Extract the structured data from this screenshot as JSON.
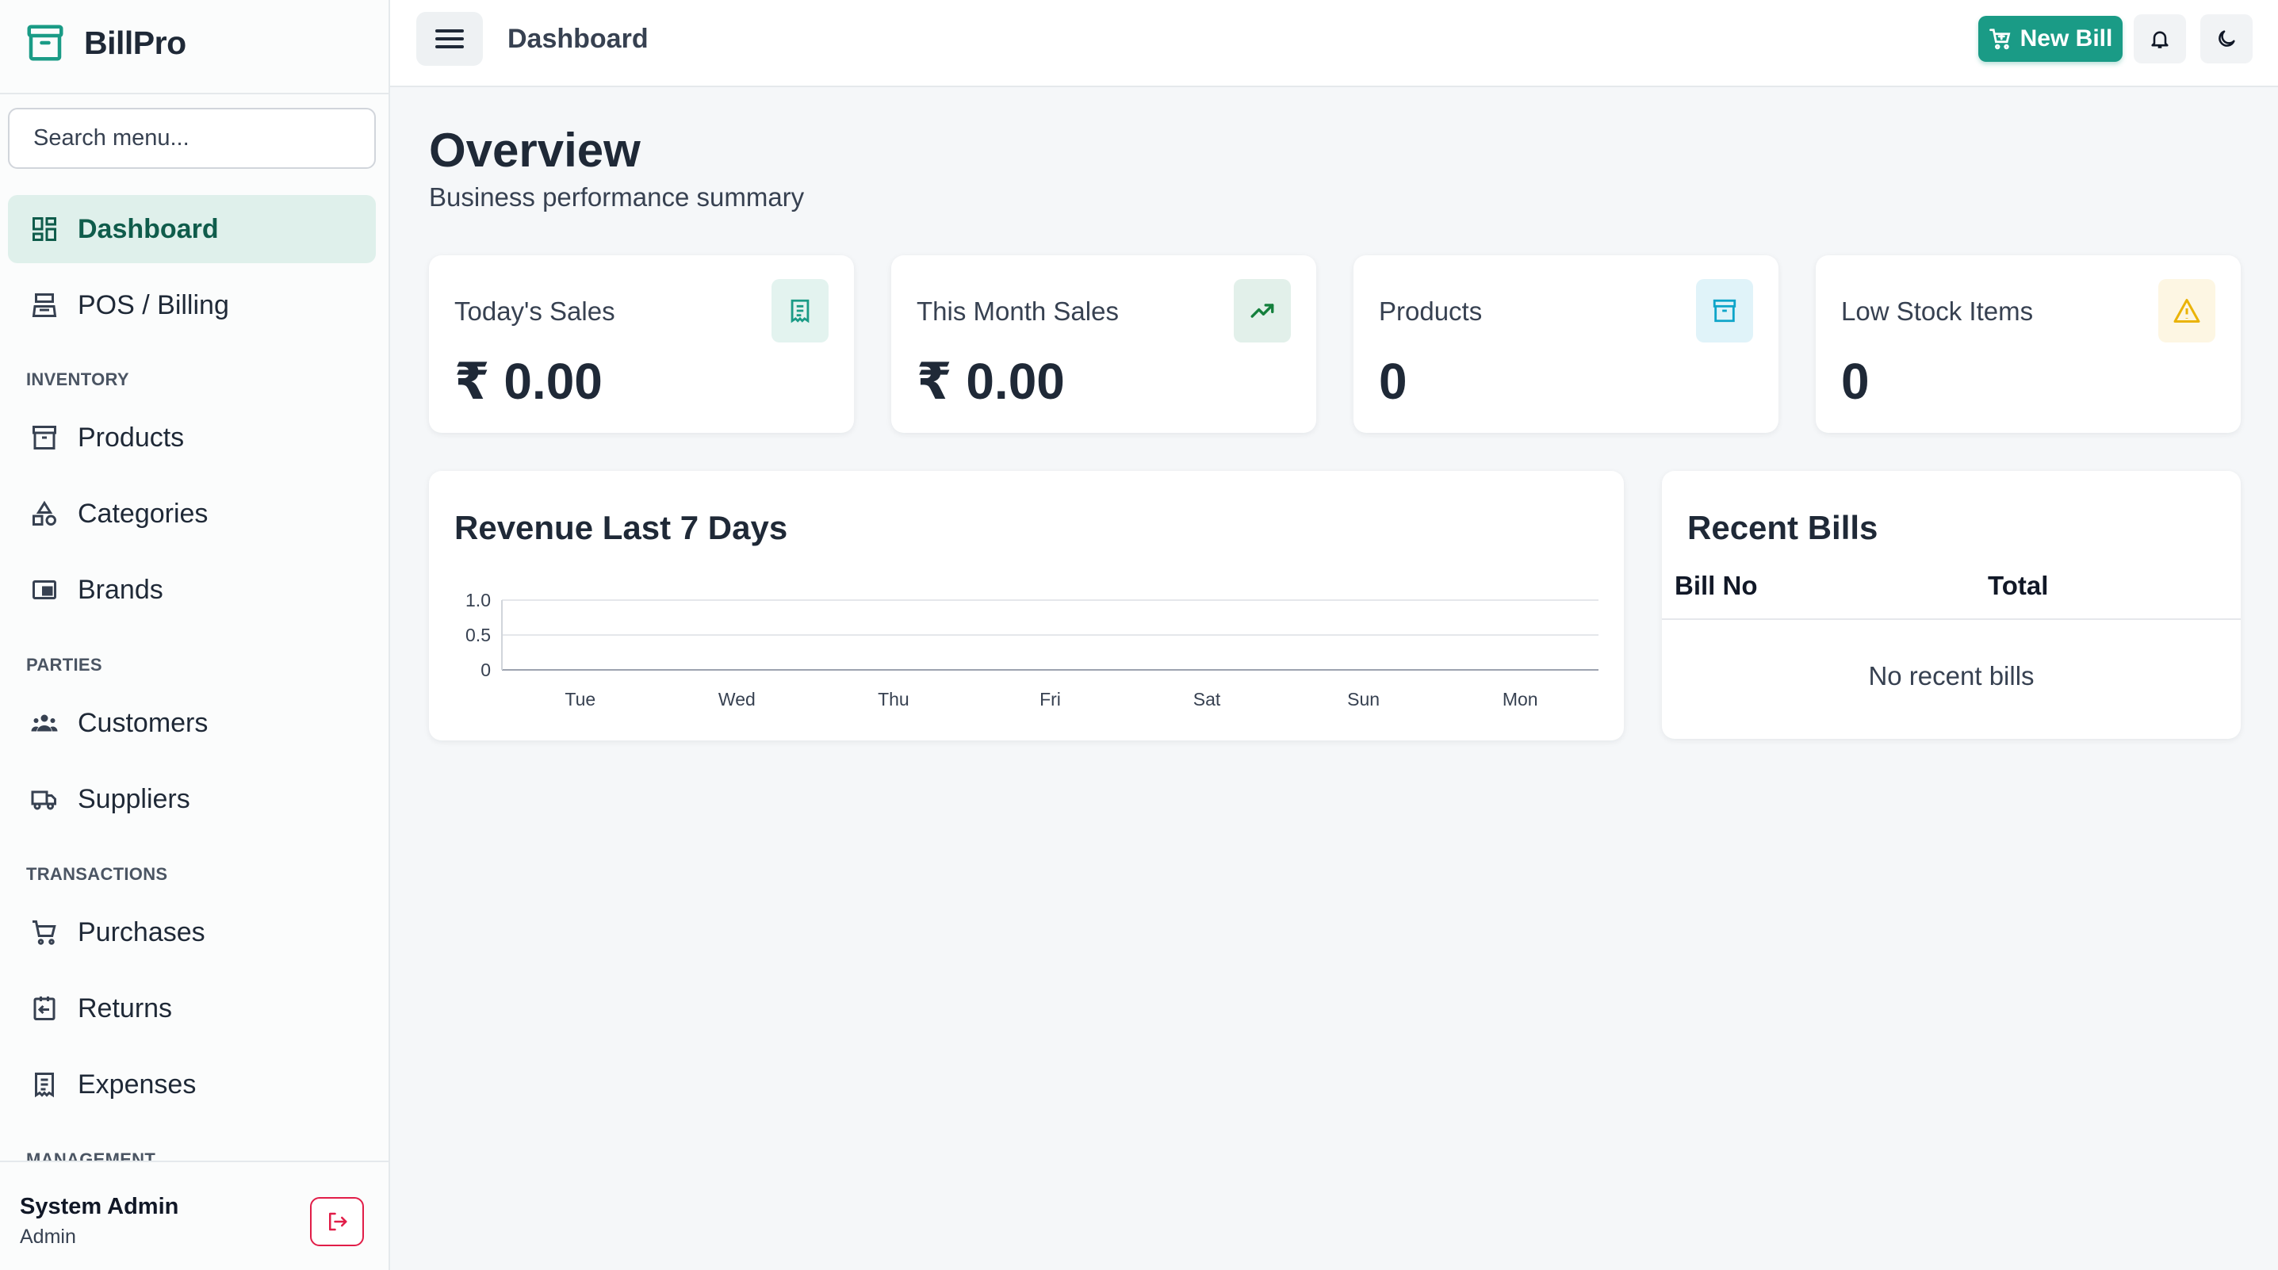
{
  "app": {
    "name": "BillPro",
    "accent": "#1a9b86"
  },
  "sidebar": {
    "search_placeholder": "Search menu...",
    "items": [
      {
        "label": "Dashboard",
        "icon": "dashboard-icon",
        "active": true
      },
      {
        "label": "POS / Billing",
        "icon": "register-icon"
      }
    ],
    "sections": [
      {
        "title": "INVENTORY",
        "items": [
          {
            "label": "Products",
            "icon": "archive-icon"
          },
          {
            "label": "Categories",
            "icon": "shapes-icon"
          },
          {
            "label": "Brands",
            "icon": "brand-icon"
          }
        ]
      },
      {
        "title": "PARTIES",
        "items": [
          {
            "label": "Customers",
            "icon": "users-icon"
          },
          {
            "label": "Suppliers",
            "icon": "truck-icon"
          }
        ]
      },
      {
        "title": "TRANSACTIONS",
        "items": [
          {
            "label": "Purchases",
            "icon": "cart-icon"
          },
          {
            "label": "Returns",
            "icon": "return-icon"
          },
          {
            "label": "Expenses",
            "icon": "receipt-icon"
          }
        ]
      },
      {
        "title": "MANAGEMENT",
        "items": []
      }
    ],
    "user": {
      "name": "System Admin",
      "role": "Admin"
    }
  },
  "header": {
    "title": "Dashboard",
    "new_bill_label": "New Bill"
  },
  "overview": {
    "title": "Overview",
    "subtitle": "Business performance summary"
  },
  "stats": [
    {
      "label": "Today's Sales",
      "value": "₹ 0.00",
      "icon": "receipt-icon",
      "icon_bg": "#e3f3ef",
      "icon_color": "#1a9b86"
    },
    {
      "label": "This Month Sales",
      "value": "₹ 0.00",
      "icon": "trending-up-icon",
      "icon_bg": "#e2f0ea",
      "icon_color": "#15803d"
    },
    {
      "label": "Products",
      "value": "0",
      "icon": "archive-icon",
      "icon_bg": "#e0f3f9",
      "icon_color": "#0ea5c9"
    },
    {
      "label": "Low Stock Items",
      "value": "0",
      "icon": "warning-icon",
      "icon_bg": "#fdf6e3",
      "icon_color": "#eab308"
    }
  ],
  "chart_data": {
    "type": "line",
    "title": "Revenue Last 7 Days",
    "categories": [
      "Tue",
      "Wed",
      "Thu",
      "Fri",
      "Sat",
      "Sun",
      "Mon"
    ],
    "yticks": [
      "1.0",
      "0.5",
      "0"
    ],
    "ylim": [
      0,
      1.0
    ],
    "series": [
      {
        "values": [
          0,
          0,
          0,
          0,
          0,
          0,
          0
        ]
      }
    ],
    "grid": true
  },
  "recent_bills": {
    "title": "Recent Bills",
    "columns": [
      "Bill No",
      "Total"
    ],
    "empty_text": "No recent bills"
  }
}
